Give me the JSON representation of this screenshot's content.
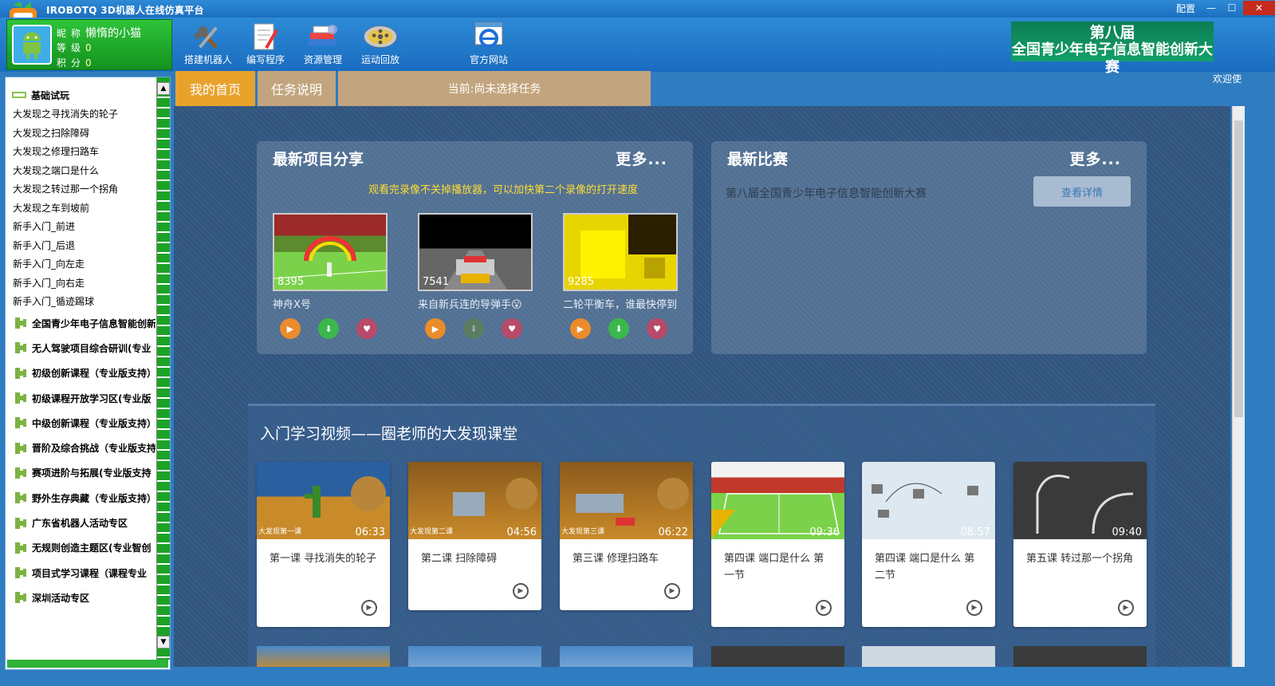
{
  "app": {
    "title": "IROBOTQ 3D机器人在线仿真平台",
    "config": "配置",
    "minimize": "—",
    "maximize": "☐",
    "close": "✕"
  },
  "user": {
    "nick_label": "昵称",
    "nick": "懒惰的小猫",
    "level_label": "等级",
    "level": "0",
    "points_label": "积分",
    "points": "0"
  },
  "toolbar": [
    {
      "label": "搭建机器人",
      "icon": "wrench-hammer-icon"
    },
    {
      "label": "编写程序",
      "icon": "notepad-pen-icon"
    },
    {
      "label": "资源管理",
      "icon": "book-stack-icon"
    },
    {
      "label": "运动回放",
      "icon": "film-reel-icon"
    },
    {
      "label": "官方网站",
      "icon": "ie-browser-icon"
    }
  ],
  "banner": {
    "line1": "第八届",
    "line2": "全国青少年电子信息智能创新大赛"
  },
  "welcome": "欢迎使",
  "sidebar": {
    "category": "基础试玩",
    "items": [
      "大发现之寻找消失的轮子",
      "大发现之扫除障碍",
      "大发现之修理扫路车",
      "大发现之端口是什么",
      "大发现之转过那一个拐角",
      "大发现之车到坡前",
      "新手入门_前进",
      "新手入门_后退",
      "新手入门_向左走",
      "新手入门_向右走",
      "新手入门_循迹踢球"
    ],
    "groups": [
      "全国青少年电子信息智能创新",
      "无人驾驶项目综合研训(专业",
      "初级创新课程（专业版支持）",
      "初级课程开放学习区(专业版",
      "中级创新课程（专业版支持）",
      "晋阶及综合挑战（专业版支持",
      "赛项进阶与拓展(专业版支持",
      "野外生存典藏（专业版支持）",
      "广东省机器人活动专区",
      "无规则创造主题区(专业智创",
      "项目式学习课程（课程专业",
      "深圳活动专区"
    ]
  },
  "tabs": {
    "home": "我的首页",
    "task": "任务说明",
    "current": "当前:尚未选择任务"
  },
  "projects": {
    "title": "最新项目分享",
    "more": "更多...",
    "note": "观看完录像不关掉播放器，可以加快第二个录像的打开速度",
    "items": [
      {
        "name": "神舟X号",
        "count": "8395"
      },
      {
        "name": "来自新兵连的导弹手😮",
        "count": "7541"
      },
      {
        "name": "二轮平衡车，谁最快停到",
        "count": "9285"
      }
    ]
  },
  "competition": {
    "title": "最新比赛",
    "more": "更多...",
    "name": "第八届全国青少年电子信息智能创新大赛",
    "button": "查看详情"
  },
  "videos": {
    "title": "入门学习视频——圈老师的大发现课堂",
    "items": [
      {
        "title": "第一课 寻找消失的轮子",
        "duration": "06:33",
        "tag": "大发现第一课"
      },
      {
        "title": "第二课 扫除障碍",
        "duration": "04:56",
        "tag": "大发现第二课"
      },
      {
        "title": "第三课 修理扫路车",
        "duration": "06:22",
        "tag": "大发现第三课"
      },
      {
        "title": "第四课 端口是什么 第一节",
        "duration": "09:36",
        "tag": ""
      },
      {
        "title": "第四课 端口是什么 第二节",
        "duration": "08:57",
        "tag": ""
      },
      {
        "title": "第五课 转过那一个拐角",
        "duration": "09:40",
        "tag": ""
      }
    ]
  },
  "colors": {
    "accent": "#e8a22c",
    "tab_inactive": "#c2a57e",
    "main_bg": "#31557f",
    "sidebar_green": "#1ca326",
    "note": "#ffdd33"
  }
}
